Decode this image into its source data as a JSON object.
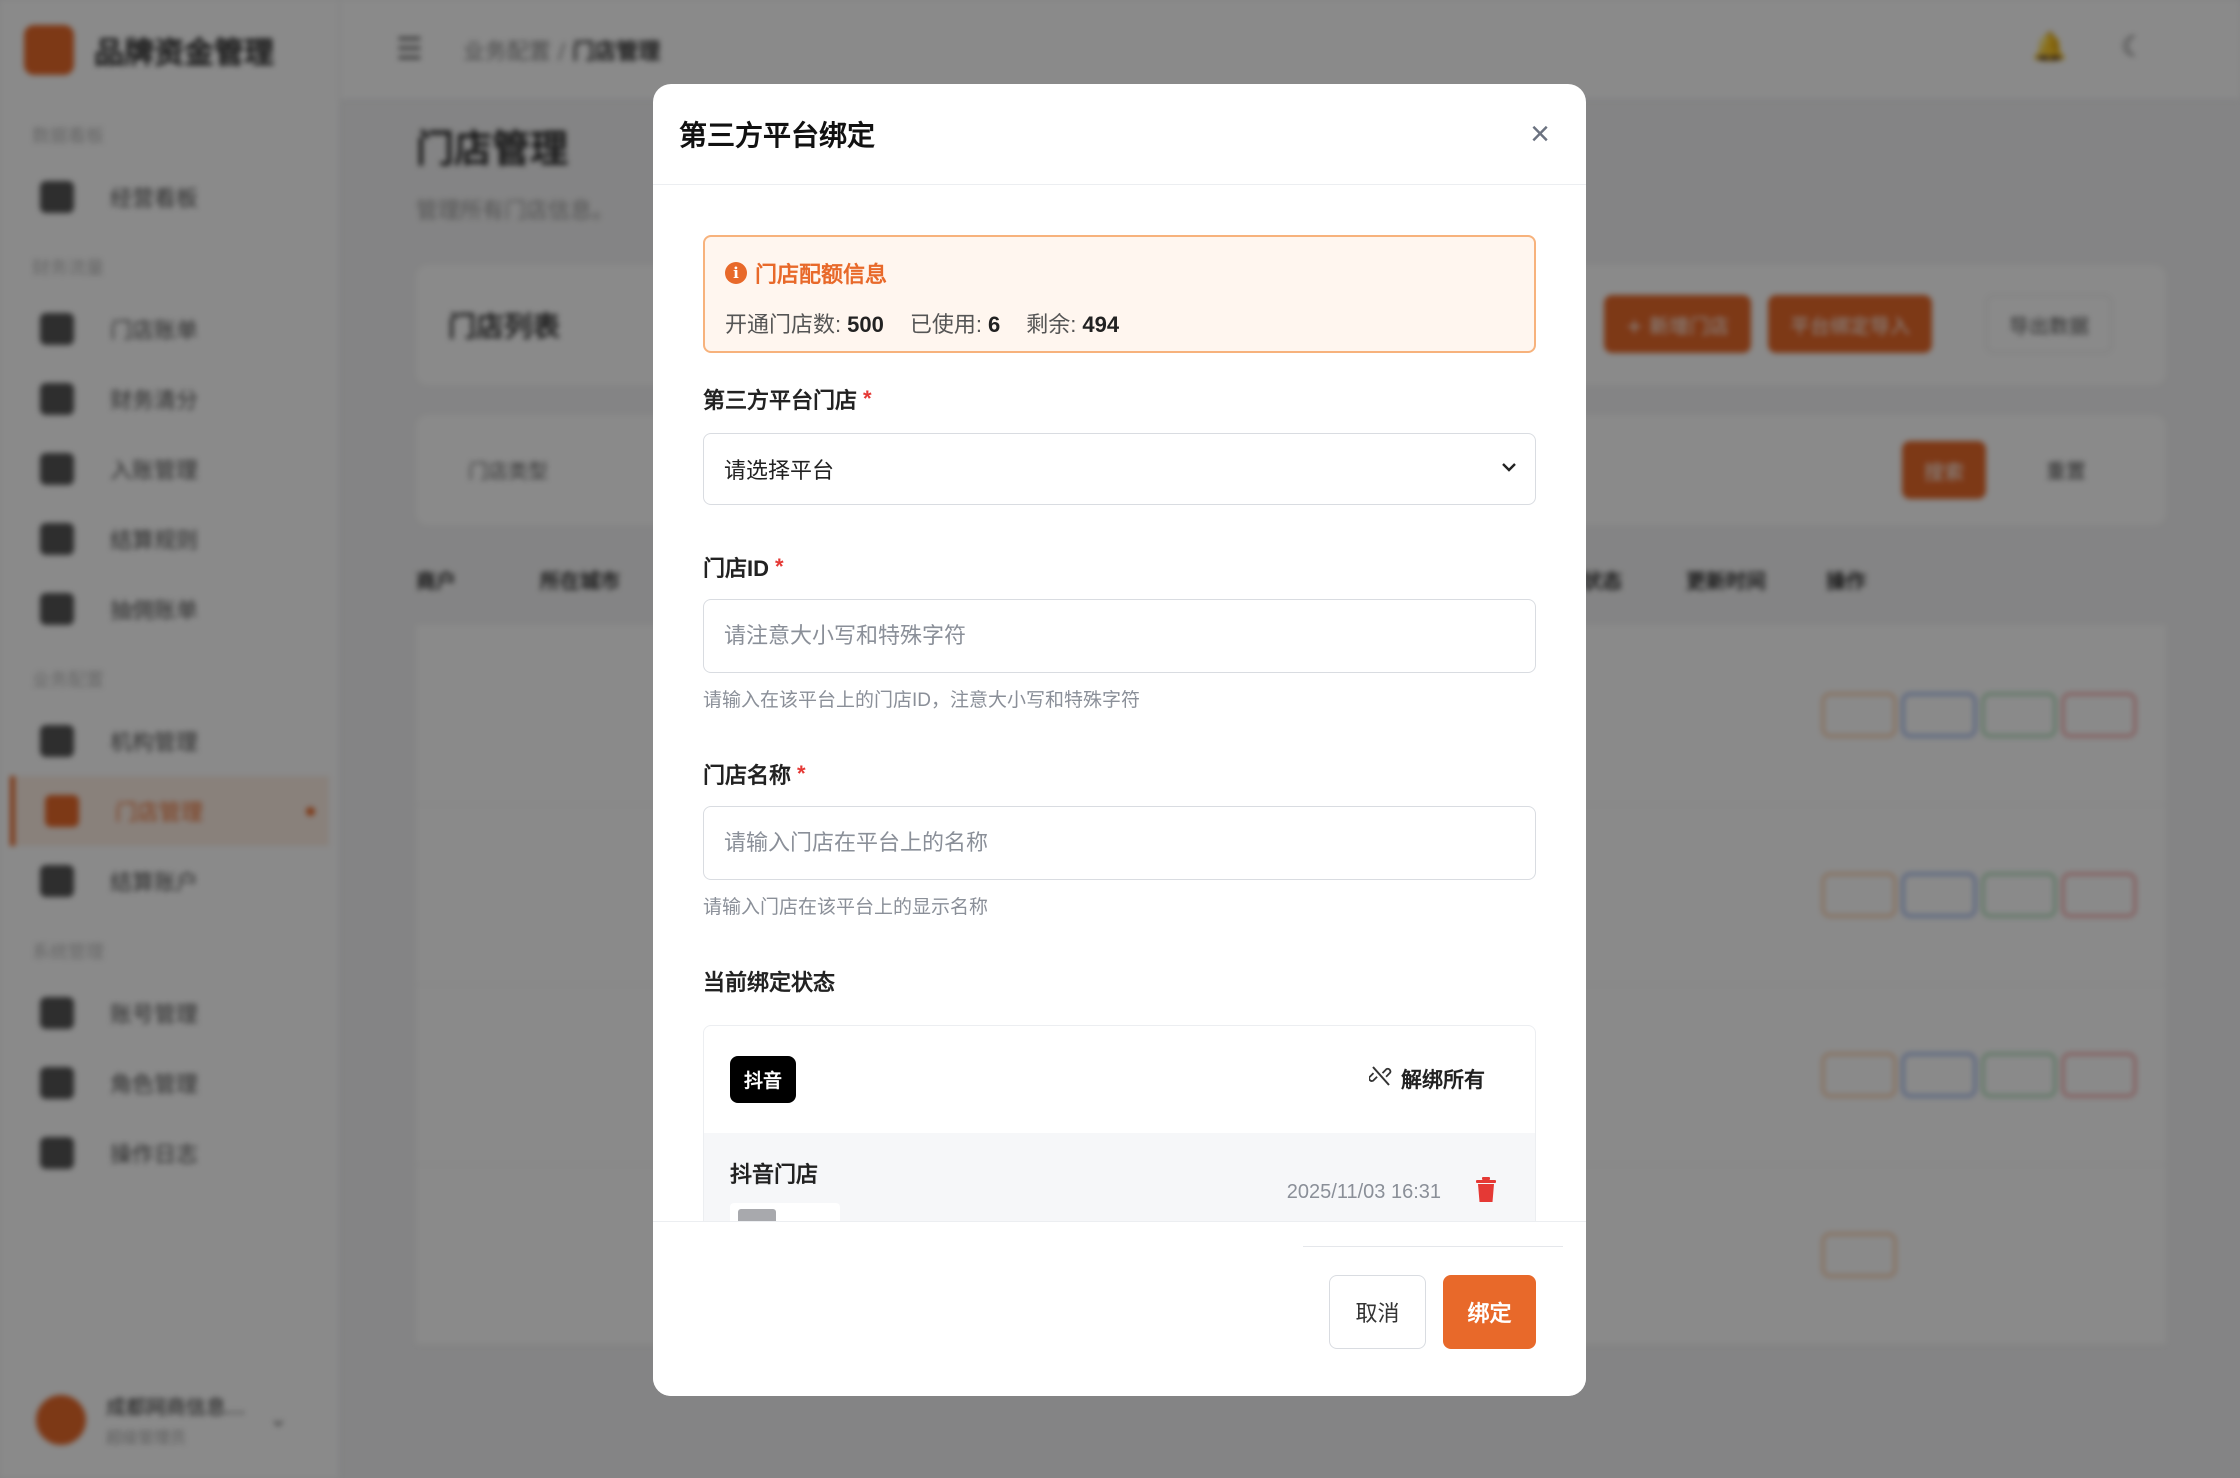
{
  "app": {
    "brand": "品牌资金管理",
    "nav_sections": [
      "数据看板",
      "财务流量",
      "业务配置",
      "系统管理"
    ],
    "nav_items": [
      "经营看板",
      "门店账单",
      "财务清分",
      "入账管理",
      "结算规则",
      "抽佣账单",
      "机构管理",
      "门店管理",
      "结算账户",
      "账号管理",
      "角色管理",
      "操作日志"
    ],
    "user": {
      "name": "成都网商信息...",
      "role": "超级管理员"
    },
    "breadcrumb": {
      "parent": "业务配置",
      "current": "门店管理"
    },
    "page_title": "门店管理",
    "page_desc": "管理所有门店信息。",
    "panel_title": "门店列表",
    "buttons": {
      "add": "+ 新增门店",
      "import": "平台绑定导入",
      "export": "导出数据",
      "search": "搜索",
      "reset": "重置"
    },
    "filter_placeholder": "门店类型",
    "table_headers": [
      "商户",
      "所在城市",
      "状态",
      "更新时间",
      "操作"
    ]
  },
  "modal": {
    "title": "第三方平台绑定",
    "close_glyph": "×",
    "quota": {
      "title": "门店配额信息",
      "total_label": "开通门店数:",
      "total_value": "500",
      "used_label": "已使用:",
      "used_value": "6",
      "remaining_label": "剩余:",
      "remaining_value": "494"
    },
    "platform_field": {
      "label": "第三方平台门店",
      "required_mark": "*",
      "selected": "请选择平台"
    },
    "store_id_field": {
      "label": "门店ID",
      "required_mark": "*",
      "placeholder": "请注意大小写和特殊字符",
      "value": "",
      "help": "请输入在该平台上的门店ID，注意大小写和特殊字符"
    },
    "store_name_field": {
      "label": "门店名称",
      "required_mark": "*",
      "placeholder": "请输入门店在平台上的名称",
      "value": "",
      "help": "请输入门店在该平台上的显示名称"
    },
    "binding_status": {
      "label": "当前绑定状态",
      "platform_badge": "抖音",
      "unbind_all_label": "解绑所有",
      "bindings": [
        {
          "name": "抖音门店",
          "time": "2025/11/03 16:31"
        }
      ]
    },
    "footer": {
      "cancel_label": "取消",
      "submit_label": "绑定"
    }
  },
  "colors": {
    "accent": "#e8692a",
    "danger": "#e53935",
    "overlay": "rgba(0,0,0,0.46)"
  }
}
